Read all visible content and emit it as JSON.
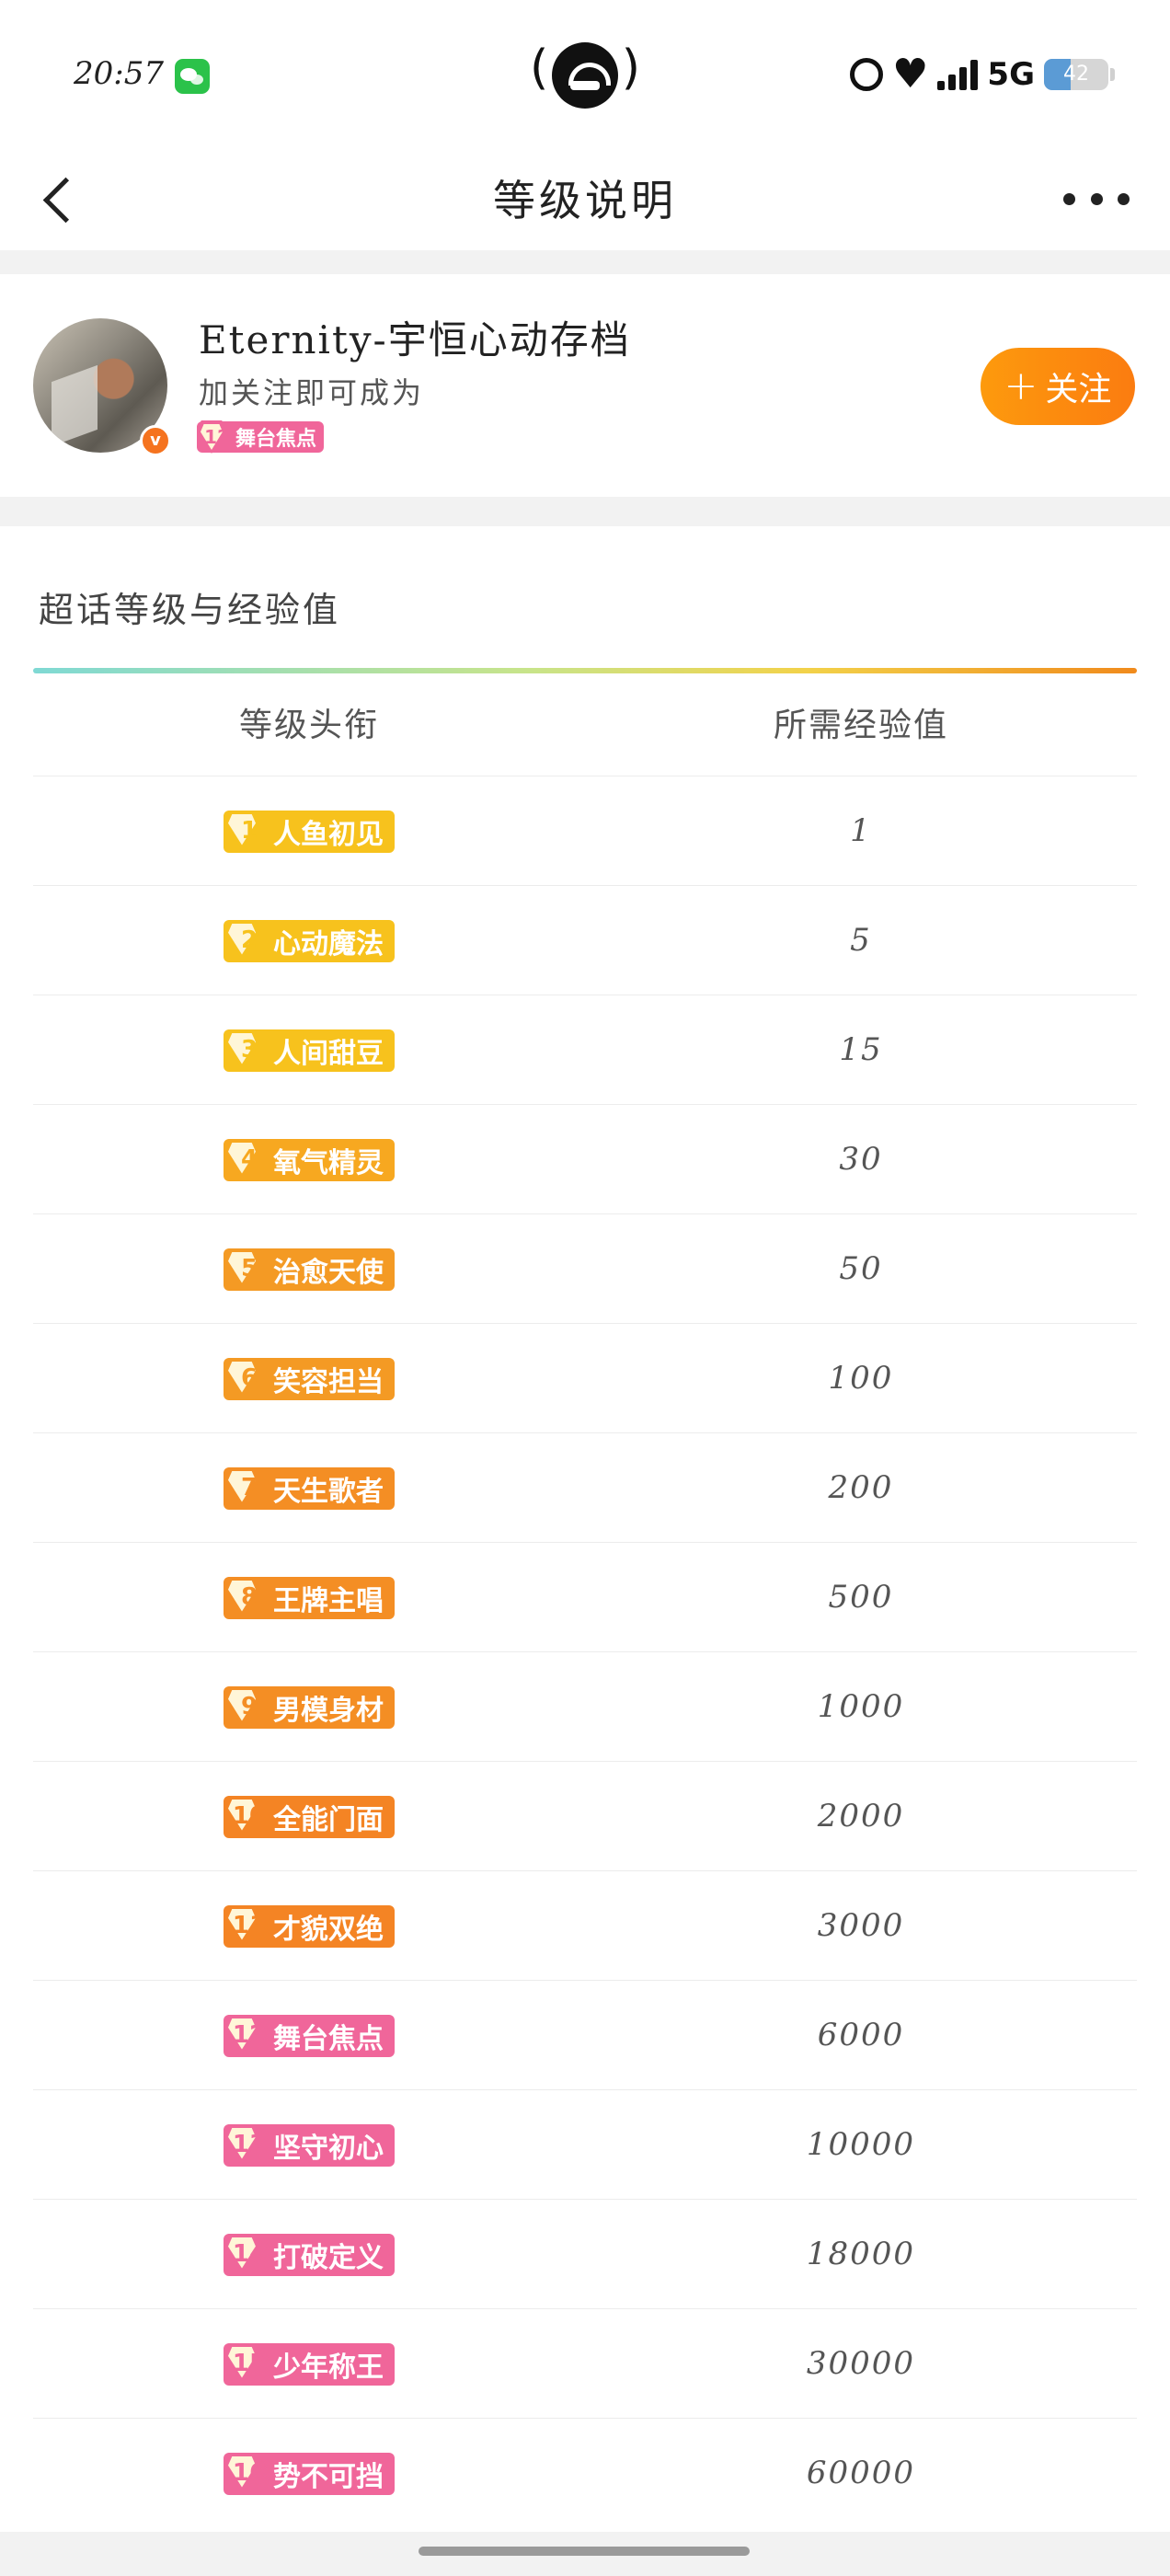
{
  "status_bar": {
    "time": "20:57",
    "network": "5G",
    "battery": "42",
    "battery_fraction": 0.42
  },
  "nav": {
    "title": "等级说明"
  },
  "profile": {
    "name": "Eternity-宇恒心动存档",
    "subtitle": "加关注即可成为",
    "badge": {
      "level": "12",
      "label": "舞台焦点"
    },
    "follow_label": "关注",
    "follow_plus": "+"
  },
  "section": {
    "title": "超话等级与经验值",
    "header": {
      "title_col": "等级头衔",
      "exp_col": "所需经验值"
    }
  },
  "levels": [
    {
      "level": "1",
      "title": "人鱼初见",
      "exp": "1",
      "color": "#f7c21d"
    },
    {
      "level": "2",
      "title": "心动魔法",
      "exp": "5",
      "color": "#f7c21d"
    },
    {
      "level": "3",
      "title": "人间甜豆",
      "exp": "15",
      "color": "#f7c21d"
    },
    {
      "level": "4",
      "title": "氧气精灵",
      "exp": "30",
      "color": "#f7a820"
    },
    {
      "level": "5",
      "title": "治愈天使",
      "exp": "50",
      "color": "#f49a24"
    },
    {
      "level": "6",
      "title": "笑容担当",
      "exp": "100",
      "color": "#f49a24"
    },
    {
      "level": "7",
      "title": "天生歌者",
      "exp": "200",
      "color": "#f48e24"
    },
    {
      "level": "8",
      "title": "王牌主唱",
      "exp": "500",
      "color": "#f48e24"
    },
    {
      "level": "9",
      "title": "男模身材",
      "exp": "1000",
      "color": "#f48e24"
    },
    {
      "level": "10",
      "title": "全能门面",
      "exp": "2000",
      "color": "#f48424"
    },
    {
      "level": "11",
      "title": "才貌双绝",
      "exp": "3000",
      "color": "#f48424"
    },
    {
      "level": "12",
      "title": "舞台焦点",
      "exp": "6000",
      "color": "#f0669a"
    },
    {
      "level": "13",
      "title": "坚守初心",
      "exp": "10000",
      "color": "#f0669a"
    },
    {
      "level": "14",
      "title": "打破定义",
      "exp": "18000",
      "color": "#f0669a"
    },
    {
      "level": "15",
      "title": "少年称王",
      "exp": "30000",
      "color": "#f0669a"
    },
    {
      "level": "16",
      "title": "势不可挡",
      "exp": "60000",
      "color": "#f0669a"
    }
  ]
}
